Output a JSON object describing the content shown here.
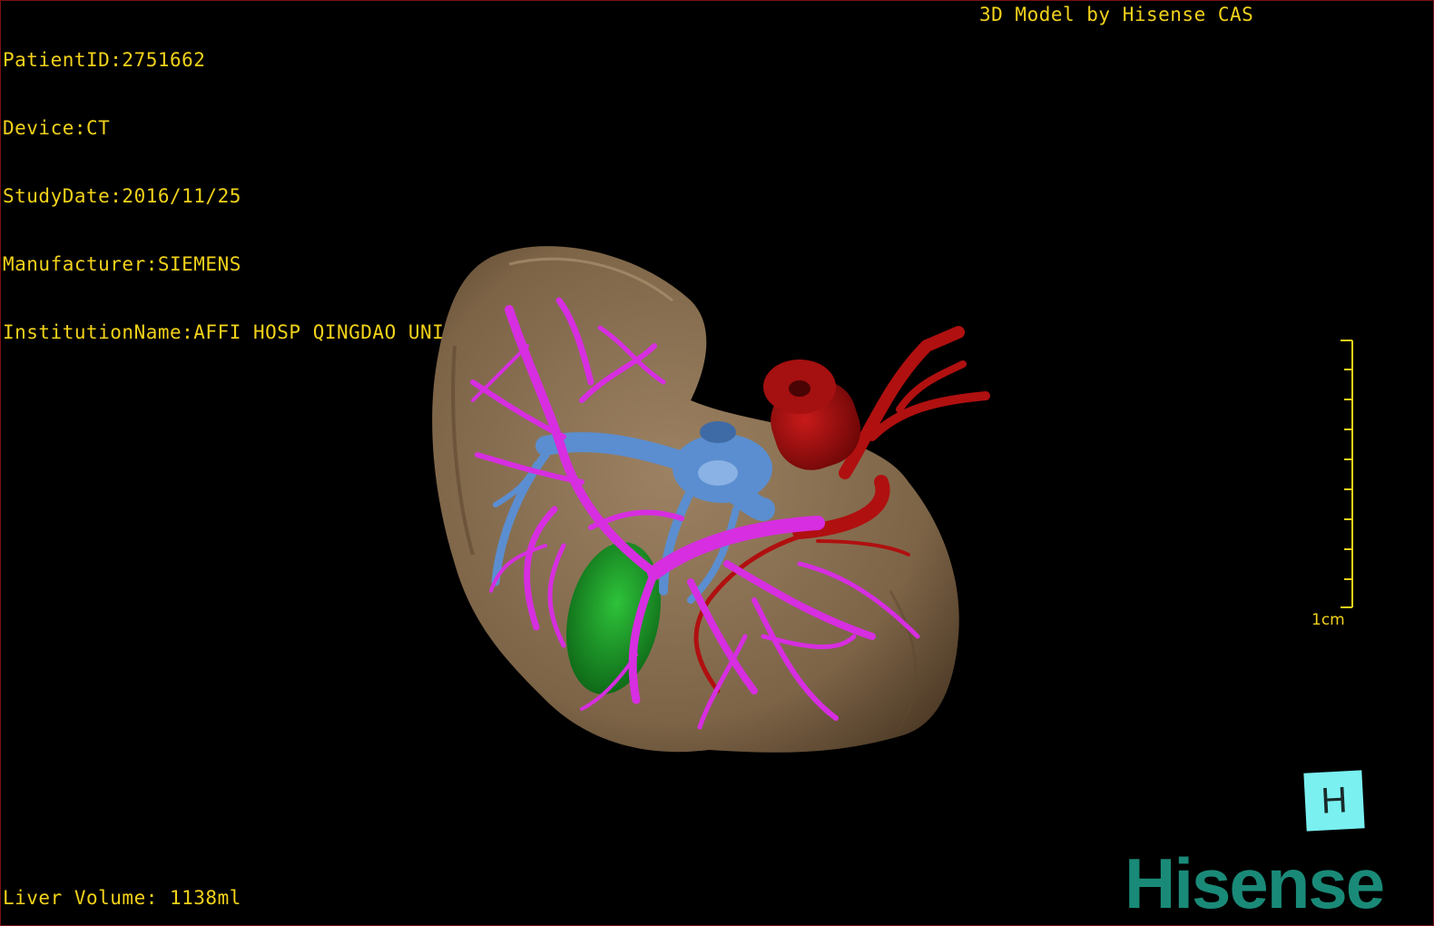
{
  "patient_info": {
    "patient_id": "PatientID:2751662",
    "device": "Device:CT",
    "study_date": "StudyDate:2016/11/25",
    "manufacturer": "Manufacturer:SIEMENS",
    "institution": "InstitutionName:AFFI HOSP QINGDAO UNI"
  },
  "header": {
    "brand_label": "3D Model by Hisense CAS"
  },
  "footer": {
    "liver_volume": "Liver Volume: 1138ml"
  },
  "scale_bar": {
    "label": "1cm"
  },
  "orientation_cube": {
    "label": "H"
  },
  "logo": {
    "text": "Hisense"
  },
  "colors": {
    "overlay_text": "#f2d21a",
    "liver": "#8b7355",
    "portal_vein": "#d62ee0",
    "hepatic_vein": "#5b8ed0",
    "artery": "#b01010",
    "lesion": "#1ea82a",
    "logo": "#1a8a78",
    "orientation": "#7af0f0"
  }
}
